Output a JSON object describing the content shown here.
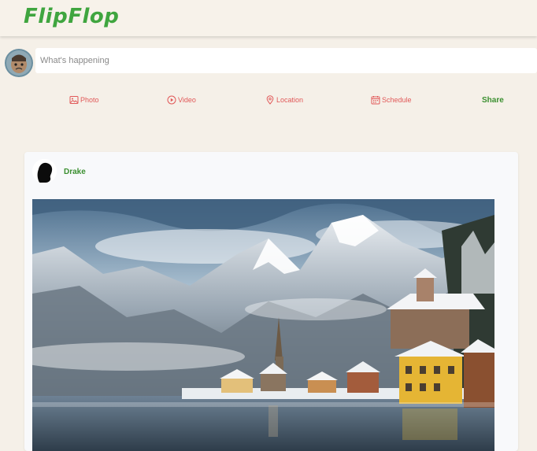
{
  "header": {
    "logo_text": "FlipFlop"
  },
  "composer": {
    "placeholder": "What's happening",
    "actions": [
      {
        "label": "Photo",
        "icon": "photo-icon"
      },
      {
        "label": "Video",
        "icon": "play-circle-icon"
      },
      {
        "label": "Location",
        "icon": "map-pin-icon"
      },
      {
        "label": "Schedule",
        "icon": "calendar-icon"
      }
    ],
    "share_label": "Share"
  },
  "post": {
    "username": "Drake",
    "image_alt": "Snowy mountain village beside a lake"
  },
  "colors": {
    "brand_green": "#3fa53f",
    "action_red": "#e15858",
    "background": "#f5f0e8"
  }
}
